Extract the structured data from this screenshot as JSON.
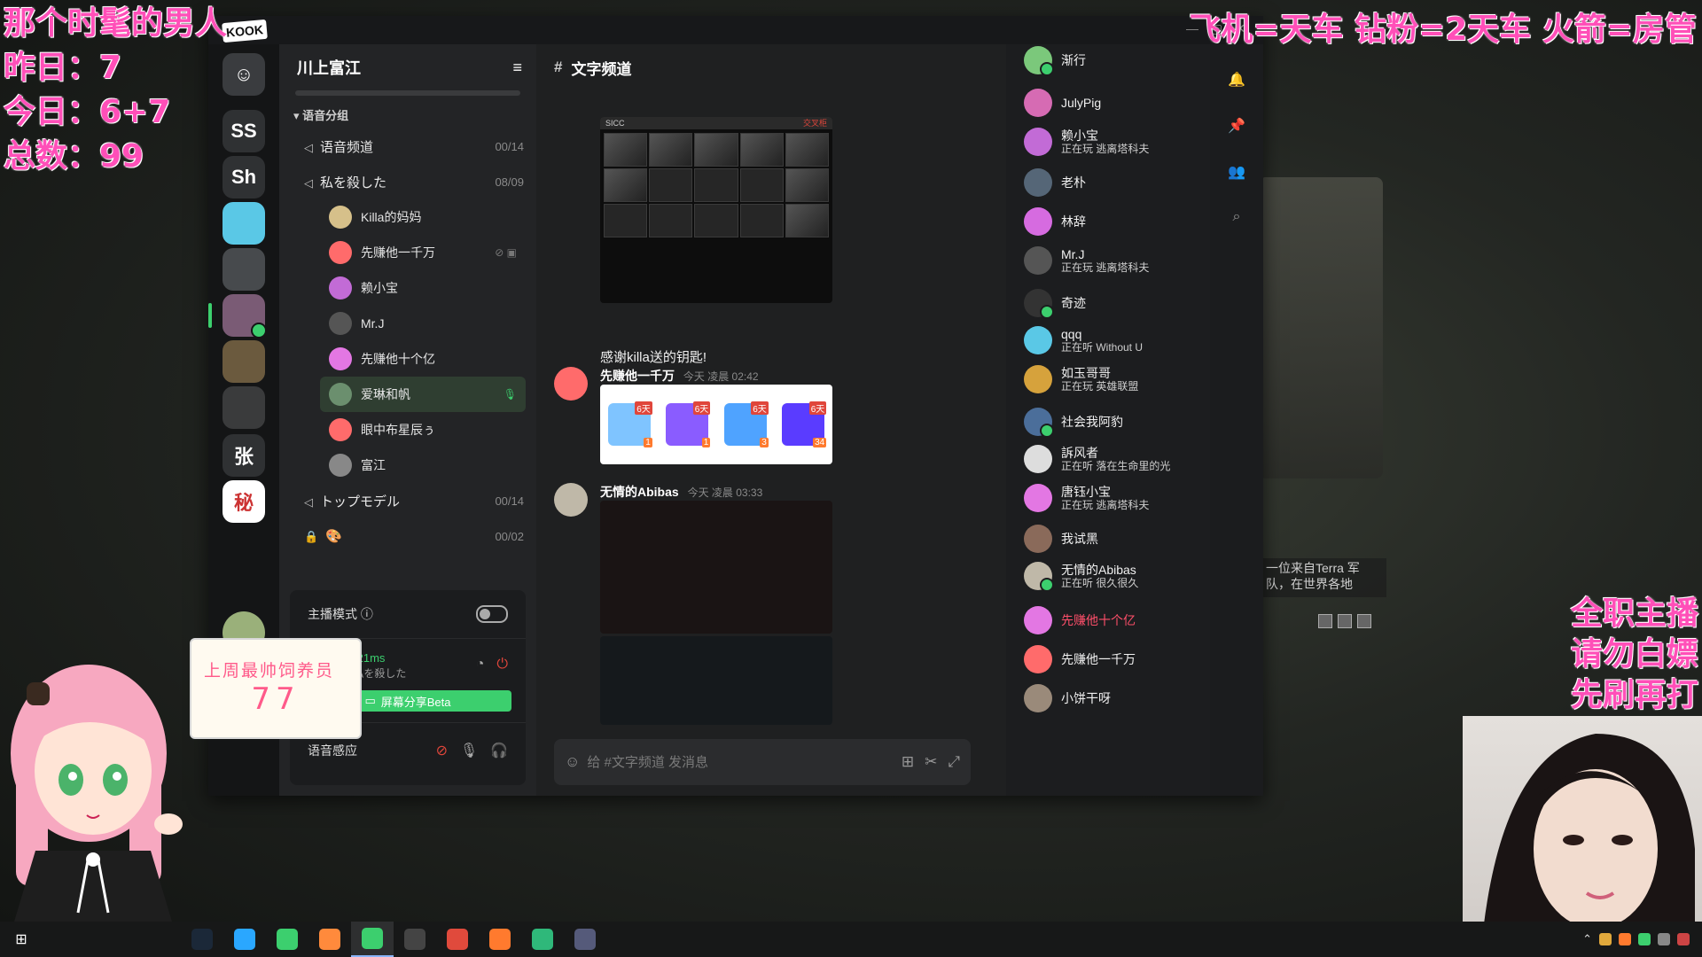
{
  "overlays": {
    "left_lines": [
      "那个时髦的男人",
      "昨日：7",
      "今日：6+7",
      "总数：99"
    ],
    "right_top": "飞机=天车 钻粉=2天车 火箭=房管",
    "right_mid": [
      "全职主播",
      "请勿白嫖",
      "先刷再打"
    ],
    "score_card": {
      "line1": "上周最帅饲养员",
      "line2": "77"
    }
  },
  "app": {
    "logo": "KOOK",
    "guilds": [
      {
        "label": "",
        "color": "#3a3c3f"
      },
      {
        "label": "SS",
        "color": "#2f3133"
      },
      {
        "label": "Sh",
        "color": "#2f3133"
      },
      {
        "label": "",
        "color": "#5ac8e6"
      },
      {
        "label": "",
        "color": "#474a4d"
      },
      {
        "label": "",
        "color": "#7a5b75"
      },
      {
        "label": "",
        "color": "#6b5a3e"
      },
      {
        "label": "",
        "color": "#3a3b3c"
      },
      {
        "label": "张",
        "color": "#2f3133"
      },
      {
        "label": "",
        "color": "#ffffff"
      }
    ],
    "server": {
      "name": "川上富江",
      "category": "语音分组",
      "channels": [
        {
          "name": "语音频道",
          "count": "00/14"
        },
        {
          "name": "私を殺した",
          "count": "08/09"
        }
      ],
      "voice_members": [
        {
          "name": "Killa的妈妈",
          "color": "#d6c08a"
        },
        {
          "name": "先赚他一千万",
          "color": "#ff6b6b"
        },
        {
          "name": "赖小宝",
          "color": "#c26bd6"
        },
        {
          "name": "Mr.J",
          "color": "#555555"
        },
        {
          "name": "先赚他十个亿",
          "color": "#e377e3"
        },
        {
          "name": "爱琳和帆",
          "color": "#6b8f6e"
        },
        {
          "name": "眼中布星辰ぅ",
          "color": "#ff6b6b"
        },
        {
          "name": "富江",
          "color": "#888888"
        }
      ],
      "more_channels": [
        {
          "name": "トップモデル",
          "count": "00/14"
        },
        {
          "name": "🎨",
          "count": "00/02"
        }
      ]
    },
    "voice_panel": {
      "streamer_mode": "主播模式 ⓘ",
      "connection": "语音连接 21ms",
      "connection_sub": "语音分组/私を殺した",
      "share_screen": "屏幕分享Beta",
      "voice_activity": "语音感应"
    },
    "chat": {
      "channel_name": "文字频道",
      "messages": [
        {
          "author": "",
          "time": "",
          "text": "感谢killa送的钥匙!"
        },
        {
          "author": "先赚他一千万",
          "time": "今天 凌晨 02:42",
          "text": ""
        },
        {
          "author": "无情的Abibas",
          "time": "今天 凌晨 03:33",
          "text": ""
        }
      ],
      "game_window_title": "SICC",
      "game_window_right": "交叉柜",
      "stickers": [
        {
          "tag": "6天",
          "num": "1",
          "color": "#7fc4ff"
        },
        {
          "tag": "6天",
          "num": "1",
          "color": "#8a5cff"
        },
        {
          "tag": "6天",
          "num": "3",
          "color": "#4fa3ff"
        },
        {
          "tag": "6天",
          "num": "34",
          "color": "#5a3cff"
        }
      ],
      "input_placeholder": "给 #文字频道 发消息"
    },
    "members": [
      {
        "name": "渐行",
        "status": "",
        "color": "#7bc87b",
        "online": true
      },
      {
        "name": "JulyPig",
        "status": "",
        "color": "#d66bb3",
        "online": false
      },
      {
        "name": "赖小宝",
        "status": "正在玩 逃离塔科夫",
        "color": "#c26bd6",
        "online": false
      },
      {
        "name": "老朴",
        "status": "",
        "color": "#556677",
        "online": false
      },
      {
        "name": "林辞",
        "status": "",
        "color": "#d66be0",
        "online": false
      },
      {
        "name": "Mr.J",
        "status": "正在玩 逃离塔科夫",
        "color": "#555555",
        "online": false
      },
      {
        "name": "奇迹",
        "status": "",
        "color": "#333333",
        "online": true
      },
      {
        "name": "qqq",
        "status": "正在听 Without U",
        "color": "#5ac8e6",
        "online": false
      },
      {
        "name": "如玉哥哥",
        "status": "正在玩 英雄联盟",
        "color": "#d6a23c",
        "online": false
      },
      {
        "name": "社会我阿豹",
        "status": "",
        "color": "#4b6e9a",
        "online": true
      },
      {
        "name": "訴风者",
        "status": "正在听 落在生命里的光",
        "color": "#dddddd",
        "online": false
      },
      {
        "name": "唐钰小宝",
        "status": "正在玩 逃离塔科夫",
        "color": "#e377e3",
        "online": false
      },
      {
        "name": "我试黑",
        "status": "",
        "color": "#8a6a5a",
        "online": false
      },
      {
        "name": "无情的Abibas",
        "status": "正在听 很久很久",
        "color": "#bfb8a8",
        "online": true
      },
      {
        "name": "先赚他十个亿",
        "status": "",
        "color": "#e377e3",
        "online": false,
        "pink": true
      },
      {
        "name": "先赚他一千万",
        "status": "",
        "color": "#ff6b6b",
        "online": false
      },
      {
        "name": "小饼干呀",
        "status": "",
        "color": "#9a8a7a",
        "online": false
      }
    ]
  },
  "background_caption": "一位来自Terra 军队，在世界各地",
  "taskbar": {
    "apps": [
      {
        "name": "steam",
        "color": "#1b2838"
      },
      {
        "name": "browser-search",
        "color": "#2aa7ff"
      },
      {
        "name": "wechat",
        "color": "#3ccf6e"
      },
      {
        "name": "game-launcher",
        "color": "#ff8a3c"
      },
      {
        "name": "kook",
        "color": "#3ccf6e"
      },
      {
        "name": "obs",
        "color": "#444444"
      },
      {
        "name": "chrome",
        "color": "#e04a3c"
      },
      {
        "name": "app-orange",
        "color": "#ff7a2e"
      },
      {
        "name": "app-green",
        "color": "#2fb87a"
      },
      {
        "name": "game",
        "color": "#555a7a"
      }
    ]
  }
}
